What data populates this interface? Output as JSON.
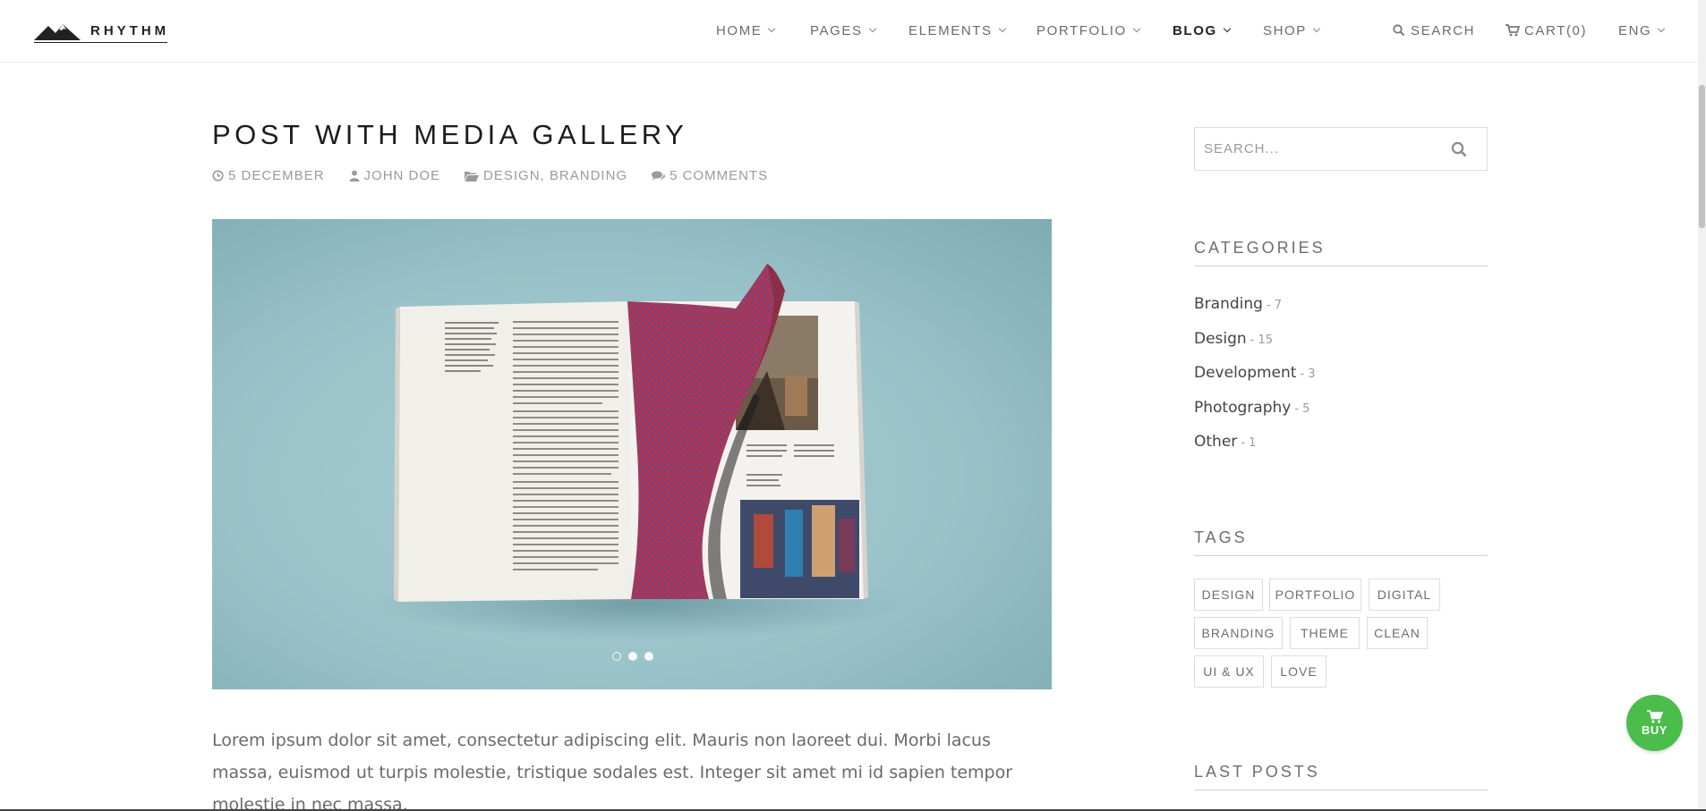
{
  "header": {
    "logo_text": "RHYTHM",
    "nav": [
      {
        "label": "HOME",
        "has_dropdown": true,
        "active": false
      },
      {
        "label": "PAGES",
        "has_dropdown": true,
        "active": false
      },
      {
        "label": "ELEMENTS",
        "has_dropdown": true,
        "active": false
      },
      {
        "label": "PORTFOLIO",
        "has_dropdown": true,
        "active": false
      },
      {
        "label": "BLOG",
        "has_dropdown": true,
        "active": true
      },
      {
        "label": "SHOP",
        "has_dropdown": true,
        "active": false
      }
    ],
    "search_label": "SEARCH",
    "cart_label": "CART(0)",
    "lang_label": "ENG"
  },
  "post": {
    "title": "POST WITH MEDIA GALLERY",
    "date": "5 DECEMBER",
    "author": "JOHN DOE",
    "categories": "DESIGN, BRANDING",
    "comments": "5 COMMENTS",
    "gallery": {
      "slide_count": 3,
      "active_slide": 1
    },
    "body": "Lorem ipsum dolor sit amet, consectetur adipiscing elit. Mauris non laoreet dui. Morbi lacus massa, euismod ut turpis molestie, tristique sodales est. Integer sit amet mi id sapien tempor molestie in nec massa."
  },
  "sidebar": {
    "search_placeholder": "SEARCH...",
    "categories_title": "CATEGORIES",
    "categories": [
      {
        "name": "Branding",
        "count": "- 7"
      },
      {
        "name": "Design",
        "count": "- 15"
      },
      {
        "name": "Development",
        "count": "- 3"
      },
      {
        "name": "Photography",
        "count": "- 5"
      },
      {
        "name": "Other",
        "count": "- 1"
      }
    ],
    "tags_title": "TAGS",
    "tags": [
      "DESIGN",
      "PORTFOLIO",
      "DIGITAL",
      "BRANDING",
      "THEME",
      "CLEAN",
      "UI & UX",
      "LOVE"
    ],
    "last_posts_title": "LAST POSTS"
  },
  "buy_button": {
    "label": "BUY",
    "color": "#4bbd4b"
  },
  "colors": {
    "accent_dark": "#222222",
    "text_muted": "#9a9a9a",
    "gallery_bg": "#9ac2c9"
  }
}
